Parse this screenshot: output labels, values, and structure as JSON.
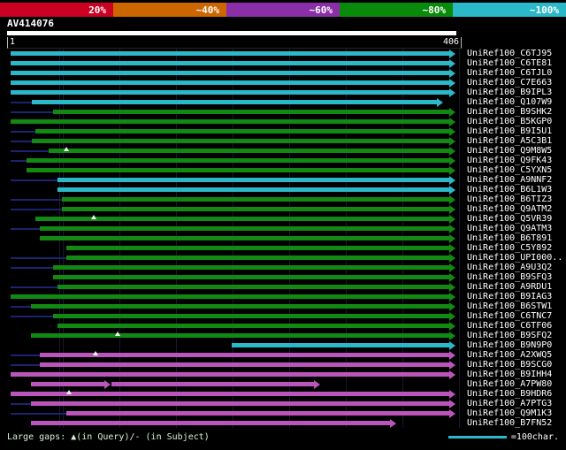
{
  "scale": {
    "segments": [
      {
        "label": "20%",
        "color": "#cc0022"
      },
      {
        "label": "~40%",
        "color": "#cc6600"
      },
      {
        "label": "~60%",
        "color": "#8b2fa8"
      },
      {
        "label": "~80%",
        "color": "#0a8a0a"
      },
      {
        "label": "~100%",
        "color": "#2bb8c8"
      }
    ]
  },
  "query": {
    "name": "AV414076",
    "ruler_start": "1",
    "ruler_end": "406"
  },
  "colors": {
    "cyan": "#2bb8c8",
    "green": "#128912",
    "magenta": "#bb55bb",
    "lead": "#1c2470"
  },
  "rows": [
    {
      "label": "UniRef100_C6TJ95",
      "color": "cyan",
      "segments": [
        {
          "start": 4,
          "end": 500
        }
      ],
      "gaps": []
    },
    {
      "label": "UniRef100_C6TE81",
      "color": "cyan",
      "segments": [
        {
          "start": 4,
          "end": 500
        }
      ],
      "gaps": []
    },
    {
      "label": "UniRef100_C6TJL0",
      "color": "cyan",
      "segments": [
        {
          "start": 4,
          "end": 500
        }
      ],
      "gaps": []
    },
    {
      "label": "UniRef100_C7E663",
      "color": "cyan",
      "segments": [
        {
          "start": 4,
          "end": 500
        }
      ],
      "gaps": []
    },
    {
      "label": "UniRef100_B9IPL3",
      "color": "cyan",
      "segments": [
        {
          "start": 4,
          "end": 500
        }
      ],
      "gaps": []
    },
    {
      "label": "UniRef100_Q107W9",
      "color": "cyan",
      "lead": 4,
      "segments": [
        {
          "start": 28,
          "end": 486
        }
      ],
      "gaps": []
    },
    {
      "label": "UniRef100_B9SHK2",
      "color": "green",
      "lead": 4,
      "segments": [
        {
          "start": 52,
          "end": 500
        }
      ],
      "gaps": []
    },
    {
      "label": "UniRef100_B5KGP0",
      "color": "green",
      "segments": [
        {
          "start": 4,
          "end": 500
        }
      ],
      "gaps": []
    },
    {
      "label": "UniRef100_B9I5U1",
      "color": "green",
      "lead": 4,
      "segments": [
        {
          "start": 32,
          "end": 500
        }
      ],
      "gaps": []
    },
    {
      "label": "UniRef100_A5C3B1",
      "color": "green",
      "lead": 4,
      "segments": [
        {
          "start": 28,
          "end": 500
        }
      ],
      "gaps": []
    },
    {
      "label": "UniRef100_Q9M8W5",
      "color": "green",
      "lead": 4,
      "segments": [
        {
          "start": 47,
          "end": 500
        }
      ],
      "gaps": [
        64
      ]
    },
    {
      "label": "UniRef100_Q9FK43",
      "color": "green",
      "lead": 4,
      "segments": [
        {
          "start": 22,
          "end": 500
        }
      ],
      "gaps": []
    },
    {
      "label": "UniRef100_C5YXN5",
      "color": "green",
      "segments": [
        {
          "start": 22,
          "end": 500
        }
      ],
      "gaps": []
    },
    {
      "label": "UniRef100_A9NNF2",
      "color": "cyan",
      "lead": 4,
      "segments": [
        {
          "start": 57,
          "end": 500
        }
      ],
      "gaps": []
    },
    {
      "label": "UniRef100_B6L1W3",
      "color": "cyan",
      "segments": [
        {
          "start": 57,
          "end": 500
        }
      ],
      "gaps": []
    },
    {
      "label": "UniRef100_B6TIZ3",
      "color": "green",
      "lead": 4,
      "segments": [
        {
          "start": 62,
          "end": 500
        }
      ],
      "gaps": []
    },
    {
      "label": "UniRef100_Q9ATM2",
      "color": "green",
      "lead": 4,
      "segments": [
        {
          "start": 62,
          "end": 500
        }
      ],
      "gaps": []
    },
    {
      "label": "UniRef100_Q5VR39",
      "color": "green",
      "segments": [
        {
          "start": 32,
          "end": 500
        }
      ],
      "gaps": [
        95
      ]
    },
    {
      "label": "UniRef100_Q9ATM3",
      "color": "green",
      "lead": 4,
      "segments": [
        {
          "start": 37,
          "end": 500
        }
      ],
      "gaps": []
    },
    {
      "label": "UniRef100_B6T891",
      "color": "green",
      "segments": [
        {
          "start": 37,
          "end": 500
        }
      ],
      "gaps": []
    },
    {
      "label": "UniRef100_C5Y892",
      "color": "green",
      "segments": [
        {
          "start": 67,
          "end": 500
        }
      ],
      "gaps": []
    },
    {
      "label": "UniRef100_UPI000..",
      "color": "green",
      "lead": 4,
      "segments": [
        {
          "start": 67,
          "end": 500
        }
      ],
      "gaps": []
    },
    {
      "label": "UniRef100_A9U3Q2",
      "color": "green",
      "lead": 4,
      "segments": [
        {
          "start": 52,
          "end": 500
        }
      ],
      "gaps": []
    },
    {
      "label": "UniRef100_B9SFQ3",
      "color": "green",
      "segments": [
        {
          "start": 52,
          "end": 500
        }
      ],
      "gaps": []
    },
    {
      "label": "UniRef100_A9RDU1",
      "color": "green",
      "lead": 4,
      "segments": [
        {
          "start": 57,
          "end": 500
        }
      ],
      "gaps": []
    },
    {
      "label": "UniRef100_B9IAG3",
      "color": "green",
      "segments": [
        {
          "start": 4,
          "end": 500
        }
      ],
      "gaps": []
    },
    {
      "label": "UniRef100_B6STW1",
      "color": "green",
      "lead": 4,
      "segments": [
        {
          "start": 27,
          "end": 500
        }
      ],
      "gaps": []
    },
    {
      "label": "UniRef100_C6TNC7",
      "color": "green",
      "lead": 4,
      "segments": [
        {
          "start": 52,
          "end": 500
        }
      ],
      "gaps": []
    },
    {
      "label": "UniRef100_C6TF06",
      "color": "green",
      "segments": [
        {
          "start": 57,
          "end": 500
        }
      ],
      "gaps": []
    },
    {
      "label": "UniRef100_B9SFQ2",
      "color": "green",
      "segments": [
        {
          "start": 27,
          "end": 500
        }
      ],
      "gaps": [
        122
      ]
    },
    {
      "label": "UniRef100_B9N9P0",
      "color": "cyan",
      "segments": [
        {
          "start": 254,
          "end": 500
        }
      ],
      "gaps": []
    },
    {
      "label": "UniRef100_A2XWQ5",
      "color": "magenta",
      "lead": 4,
      "segments": [
        {
          "start": 37,
          "end": 500
        }
      ],
      "gaps": [
        97
      ]
    },
    {
      "label": "UniRef100_B9SCG0",
      "color": "magenta",
      "lead": 4,
      "segments": [
        {
          "start": 37,
          "end": 500
        }
      ],
      "gaps": []
    },
    {
      "label": "UniRef100_B9IHH4",
      "color": "magenta",
      "segments": [
        {
          "start": 4,
          "end": 500
        }
      ],
      "gaps": []
    },
    {
      "label": "UniRef100_A7PW80",
      "color": "magenta",
      "segments": [
        {
          "start": 27,
          "end": 110
        },
        {
          "start": 118,
          "end": 347
        }
      ],
      "gaps": []
    },
    {
      "label": "UniRef100_B9HDR6",
      "color": "magenta",
      "segments": [
        {
          "start": 4,
          "end": 500
        }
      ],
      "gaps": [
        67
      ]
    },
    {
      "label": "UniRef100_A7PTG3",
      "color": "magenta",
      "lead": 4,
      "segments": [
        {
          "start": 27,
          "end": 500
        }
      ],
      "gaps": []
    },
    {
      "label": "UniRef100_Q9M1K3",
      "color": "magenta",
      "lead": 4,
      "segments": [
        {
          "start": 67,
          "end": 500
        }
      ],
      "gaps": []
    },
    {
      "label": "UniRef100_B7FN52",
      "color": "magenta",
      "segments": [
        {
          "start": 27,
          "end": 433
        }
      ],
      "gaps": []
    }
  ],
  "footer": {
    "gaps_label": "Large gaps: ▲(in Query)/- (in Subject)",
    "scale_label": "=100char."
  }
}
